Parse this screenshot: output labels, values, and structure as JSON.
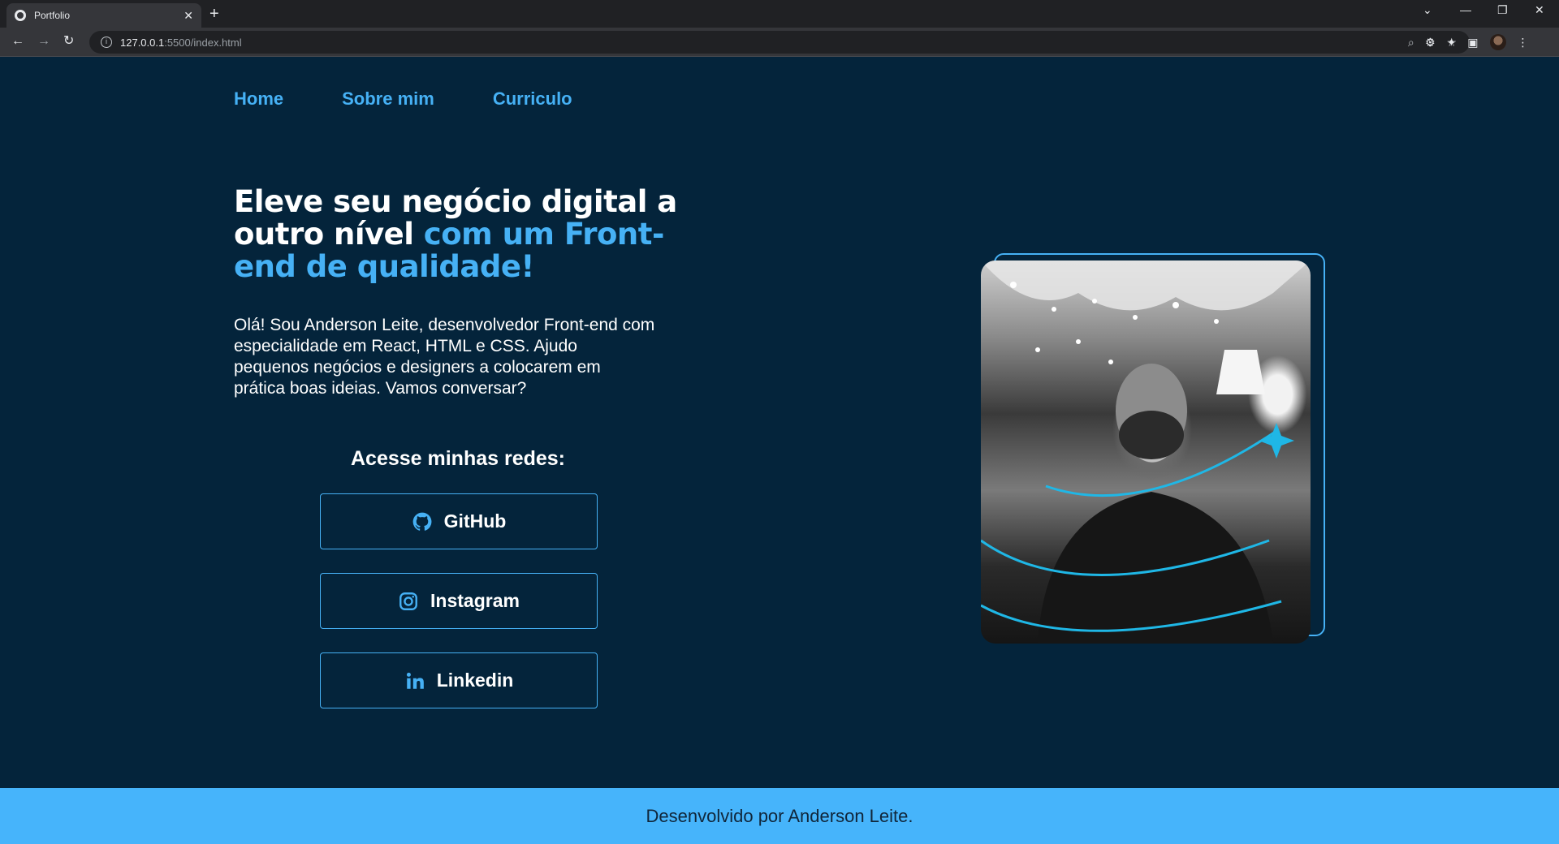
{
  "browser": {
    "tab_title": "Portfolio",
    "url_host": "127.0.0.1",
    "url_path": ":5500/index.html"
  },
  "nav": {
    "home": "Home",
    "about": "Sobre mim",
    "resume": "Curriculo"
  },
  "hero": {
    "headline_part1": "Eleve seu negócio digital a outro nível ",
    "headline_part2": "com um Front-end de qualidade!",
    "bio": "Olá! Sou Anderson Leite, desenvolvedor Front-end com especialidade em React, HTML e CSS. Ajudo pequenos negócios e designers a colocarem em prática boas ideias. Vamos conversar?"
  },
  "socials": {
    "title": "Acesse minhas redes:",
    "items": [
      {
        "label": "GitHub",
        "icon": "github-icon"
      },
      {
        "label": "Instagram",
        "icon": "instagram-icon"
      },
      {
        "label": "Linkedin",
        "icon": "linkedin-icon"
      }
    ]
  },
  "footer": {
    "text": "Desenvolvido por Anderson Leite."
  },
  "colors": {
    "background": "#04243b",
    "accent": "#46b1f5",
    "footer": "#46b4fb"
  }
}
